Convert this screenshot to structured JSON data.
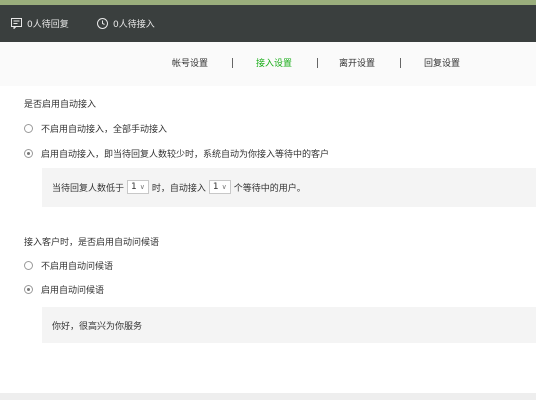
{
  "header": {
    "pending_reply": "0人待回复",
    "pending_connect": "0人待接入"
  },
  "tabs": [
    {
      "label": "帐号设置",
      "active": false
    },
    {
      "label": "接入设置",
      "active": true
    },
    {
      "label": "离开设置",
      "active": false
    },
    {
      "label": "回复设置",
      "active": false
    }
  ],
  "tab_separator": "|",
  "auto_connect": {
    "title": "是否启用自动接入",
    "options": [
      {
        "label": "不启用自动接入，全部手动接入",
        "checked": false
      },
      {
        "label": "启用自动接入，即当待回复人数较少时，系统自动为你接入等待中的客户",
        "checked": true
      }
    ],
    "rule": {
      "prefix": "当待回复人数低于",
      "threshold_value": "1",
      "middle": "时，自动接入",
      "count_value": "1",
      "suffix": "个等待中的用户。"
    }
  },
  "greeting": {
    "title": "接入客户时，是否启用自动问候语",
    "options": [
      {
        "label": "不启用自动问候语",
        "checked": false
      },
      {
        "label": "启用自动问候语",
        "checked": true
      }
    ],
    "message": "你好，很高兴为你服务"
  },
  "colors": {
    "accent": "#1aad19",
    "topbar": "#3a3f3e",
    "top_strip": "#9aae7c"
  }
}
